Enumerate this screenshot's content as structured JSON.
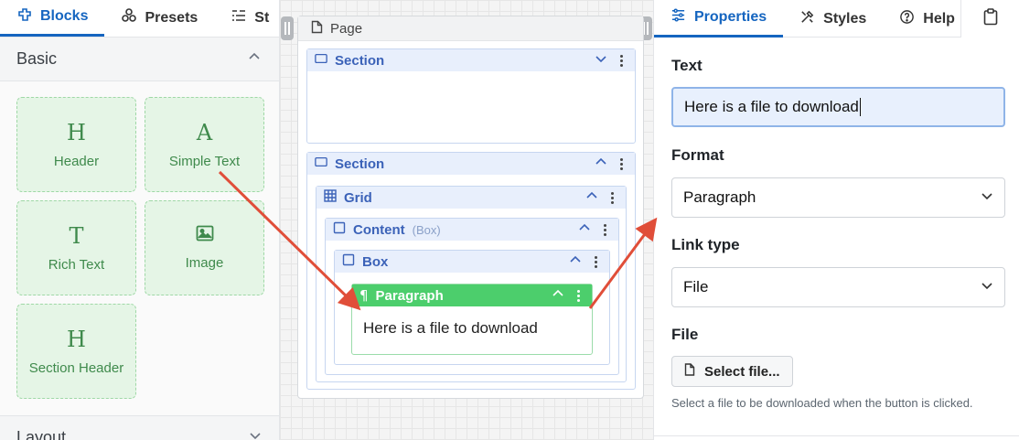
{
  "left_panel": {
    "tabs": [
      {
        "label": "Blocks",
        "icon": "blocks-icon",
        "active": true
      },
      {
        "label": "Presets",
        "icon": "presets-icon",
        "active": false
      },
      {
        "label": "St",
        "icon": "structure-icon",
        "active": false
      }
    ],
    "basic_group": {
      "title": "Basic",
      "expanded": true
    },
    "blocks": [
      {
        "glyph": "H",
        "label": "Header"
      },
      {
        "glyph": "A",
        "label": "Simple Text"
      },
      {
        "glyph": "T",
        "label": "Rich Text"
      },
      {
        "glyph": "",
        "icon": "image-icon",
        "label": "Image"
      },
      {
        "glyph": "H",
        "label": "Section Header"
      }
    ],
    "layout_group": {
      "title": "Layout",
      "expanded": false
    }
  },
  "canvas": {
    "page_label": "Page",
    "section1": {
      "label": "Section"
    },
    "section2": {
      "label": "Section"
    },
    "grid": {
      "label": "Grid"
    },
    "content": {
      "label": "Content",
      "sub": "(Box)"
    },
    "box": {
      "label": "Box"
    },
    "paragraph": {
      "label": "Paragraph",
      "text": "Here is a file to download"
    }
  },
  "right_panel": {
    "tabs": [
      {
        "label": "Properties",
        "icon": "properties-icon",
        "active": true
      },
      {
        "label": "Styles",
        "icon": "styles-icon",
        "active": false
      },
      {
        "label": "Help",
        "icon": "help-icon",
        "active": false
      }
    ],
    "text_label": "Text",
    "text_value": "Here is a file to download",
    "format_label": "Format",
    "format_value": "Paragraph",
    "link_type_label": "Link type",
    "link_type_value": "File",
    "file_label": "File",
    "select_file_label": "Select file...",
    "help_text": "Select a file to be downloaded when the button is clicked."
  },
  "colors": {
    "accent": "#1565c0",
    "block_bg": "#e5f5e6",
    "block_text": "#3f8a4c",
    "node_header": "#e8effc",
    "paragraph_header": "#4cce6c",
    "arrow": "#e04e39"
  }
}
